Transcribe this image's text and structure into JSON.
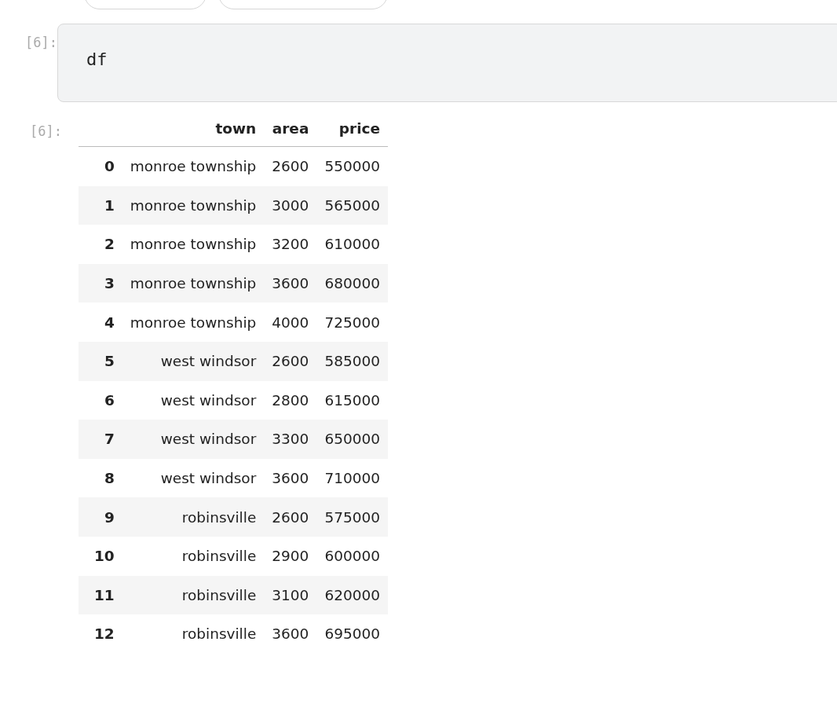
{
  "input_cell": {
    "prompt": "[6]:",
    "code": "df"
  },
  "output_cell": {
    "prompt": "[6]:",
    "table": {
      "columns": [
        "town",
        "area",
        "price"
      ],
      "rows": [
        {
          "index": "0",
          "cells": [
            "monroe township",
            "2600",
            "550000"
          ]
        },
        {
          "index": "1",
          "cells": [
            "monroe township",
            "3000",
            "565000"
          ]
        },
        {
          "index": "2",
          "cells": [
            "monroe township",
            "3200",
            "610000"
          ]
        },
        {
          "index": "3",
          "cells": [
            "monroe township",
            "3600",
            "680000"
          ]
        },
        {
          "index": "4",
          "cells": [
            "monroe township",
            "4000",
            "725000"
          ]
        },
        {
          "index": "5",
          "cells": [
            "west windsor",
            "2600",
            "585000"
          ]
        },
        {
          "index": "6",
          "cells": [
            "west windsor",
            "2800",
            "615000"
          ]
        },
        {
          "index": "7",
          "cells": [
            "west windsor",
            "3300",
            "650000"
          ]
        },
        {
          "index": "8",
          "cells": [
            "west windsor",
            "3600",
            "710000"
          ]
        },
        {
          "index": "9",
          "cells": [
            "robinsville",
            "2600",
            "575000"
          ]
        },
        {
          "index": "10",
          "cells": [
            "robinsville",
            "2900",
            "600000"
          ]
        },
        {
          "index": "11",
          "cells": [
            "robinsville",
            "3100",
            "620000"
          ]
        },
        {
          "index": "12",
          "cells": [
            "robinsville",
            "3600",
            "695000"
          ]
        }
      ]
    }
  }
}
